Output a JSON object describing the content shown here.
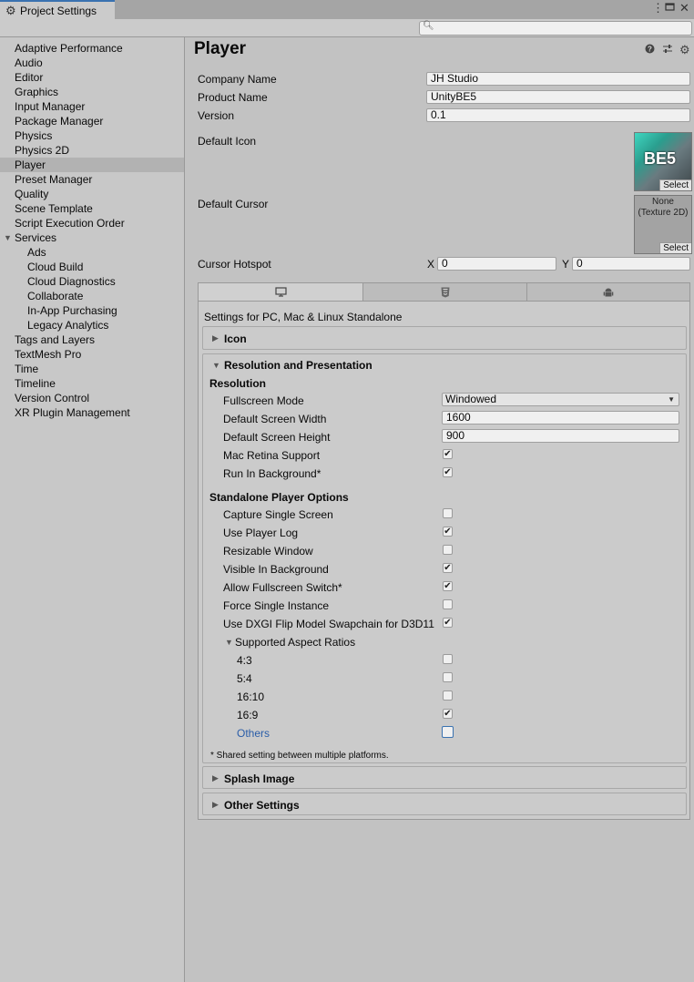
{
  "window": {
    "tab_title": "Project Settings",
    "icons": [
      "gear-icon",
      "more-icon",
      "maximize-icon",
      "close-icon"
    ]
  },
  "search": {
    "placeholder": ""
  },
  "nav": {
    "items": [
      {
        "label": "Adaptive Performance",
        "indent": 0,
        "selected": false
      },
      {
        "label": "Audio",
        "indent": 0,
        "selected": false
      },
      {
        "label": "Editor",
        "indent": 0,
        "selected": false
      },
      {
        "label": "Graphics",
        "indent": 0,
        "selected": false
      },
      {
        "label": "Input Manager",
        "indent": 0,
        "selected": false
      },
      {
        "label": "Package Manager",
        "indent": 0,
        "selected": false
      },
      {
        "label": "Physics",
        "indent": 0,
        "selected": false
      },
      {
        "label": "Physics 2D",
        "indent": 0,
        "selected": false
      },
      {
        "label": "Player",
        "indent": 0,
        "selected": true
      },
      {
        "label": "Preset Manager",
        "indent": 0,
        "selected": false
      },
      {
        "label": "Quality",
        "indent": 0,
        "selected": false
      },
      {
        "label": "Scene Template",
        "indent": 0,
        "selected": false
      },
      {
        "label": "Script Execution Order",
        "indent": 0,
        "selected": false
      },
      {
        "label": "Services",
        "indent": 0,
        "selected": false,
        "expanded": true
      },
      {
        "label": "Ads",
        "indent": 1,
        "selected": false
      },
      {
        "label": "Cloud Build",
        "indent": 1,
        "selected": false
      },
      {
        "label": "Cloud Diagnostics",
        "indent": 1,
        "selected": false
      },
      {
        "label": "Collaborate",
        "indent": 1,
        "selected": false
      },
      {
        "label": "In-App Purchasing",
        "indent": 1,
        "selected": false
      },
      {
        "label": "Legacy Analytics",
        "indent": 1,
        "selected": false
      },
      {
        "label": "Tags and Layers",
        "indent": 0,
        "selected": false
      },
      {
        "label": "TextMesh Pro",
        "indent": 0,
        "selected": false
      },
      {
        "label": "Time",
        "indent": 0,
        "selected": false
      },
      {
        "label": "Timeline",
        "indent": 0,
        "selected": false
      },
      {
        "label": "Version Control",
        "indent": 0,
        "selected": false
      },
      {
        "label": "XR Plugin Management",
        "indent": 0,
        "selected": false
      }
    ]
  },
  "player": {
    "title": "Player",
    "header_icons": [
      "help-icon",
      "presets-icon",
      "settings-icon"
    ],
    "company_name_label": "Company Name",
    "company_name": "JH Studio",
    "product_name_label": "Product Name",
    "product_name": "UnityBE5",
    "version_label": "Version",
    "version": "0.1",
    "default_icon_label": "Default Icon",
    "icon_thumb_text": "BE5",
    "icon_select": "Select",
    "default_cursor_label": "Default Cursor",
    "cursor_none_line1": "None",
    "cursor_none_line2": "(Texture 2D)",
    "cursor_select": "Select",
    "cursor_hotspot_label": "Cursor Hotspot",
    "hotspot_x_label": "X",
    "hotspot_x": "0",
    "hotspot_y_label": "Y",
    "hotspot_y": "0"
  },
  "platform": {
    "tabs": [
      {
        "icon": "monitor-icon",
        "active": true
      },
      {
        "icon": "html5-icon",
        "active": false
      },
      {
        "icon": "android-icon",
        "active": false
      }
    ],
    "settings_for": "Settings for PC, Mac & Linux Standalone",
    "icon_section": "Icon",
    "res_section": "Resolution and Presentation",
    "resolution_header": "Resolution",
    "fullscreen_mode_label": "Fullscreen Mode",
    "fullscreen_mode": "Windowed",
    "width_label": "Default Screen Width",
    "width": "1600",
    "height_label": "Default Screen Height",
    "height": "900",
    "mac_retina_label": "Mac Retina Support",
    "mac_retina": true,
    "run_bg_label": "Run In Background*",
    "run_bg": true,
    "standalone_header": "Standalone Player Options",
    "options": [
      {
        "label": "Capture Single Screen",
        "checked": false
      },
      {
        "label": "Use Player Log",
        "checked": true
      },
      {
        "label": "Resizable Window",
        "checked": false
      },
      {
        "label": "Visible In Background",
        "checked": true
      },
      {
        "label": "Allow Fullscreen Switch*",
        "checked": true
      },
      {
        "label": "Force Single Instance",
        "checked": false
      },
      {
        "label": "Use DXGI Flip Model Swapchain for D3D11",
        "checked": true
      }
    ],
    "aspect_header": "Supported Aspect Ratios",
    "aspects": [
      {
        "label": "4:3",
        "checked": false
      },
      {
        "label": "5:4",
        "checked": false
      },
      {
        "label": "16:10",
        "checked": false
      },
      {
        "label": "16:9",
        "checked": true
      },
      {
        "label": "Others",
        "checked": false
      }
    ],
    "shared_note": "* Shared setting between multiple platforms.",
    "splash_section": "Splash Image",
    "other_section": "Other Settings"
  }
}
